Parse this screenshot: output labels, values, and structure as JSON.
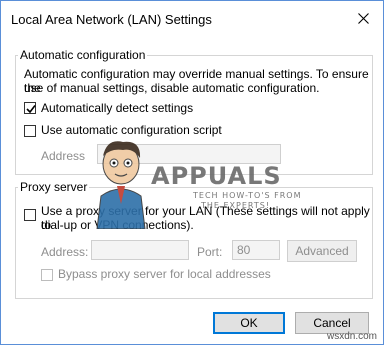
{
  "window": {
    "title": "Local Area Network (LAN) Settings"
  },
  "automatic": {
    "legend": "Automatic configuration",
    "description_line1": "Automatic configuration may override manual settings.  To ensure the",
    "description_line2": "use of manual settings, disable automatic configuration.",
    "detect_label": "Automatically detect settings",
    "detect_checked": true,
    "script_label": "Use automatic configuration script",
    "script_checked": false,
    "address_label": "Address",
    "address_value": ""
  },
  "proxy": {
    "legend": "Proxy server",
    "use_proxy_line1": "Use a proxy server for your LAN (These settings will not apply to",
    "use_proxy_line2": "dial-up or VPN connections).",
    "use_proxy_checked": false,
    "address_label": "Address:",
    "address_value": "",
    "port_label": "Port:",
    "port_value": "80",
    "advanced_label": "Advanced",
    "bypass_label": "Bypass proxy server for local addresses",
    "bypass_checked": false
  },
  "buttons": {
    "ok": "OK",
    "cancel": "Cancel"
  },
  "watermark": {
    "brand": "APPUALS",
    "tagline_line1": "TECH HOW-TO'S FROM",
    "tagline_line2": "THE EXPERTS!",
    "site": "wsxdn.com"
  },
  "colors": {
    "window_border": "#5a8fd8",
    "primary_button_border": "#0078d7"
  }
}
